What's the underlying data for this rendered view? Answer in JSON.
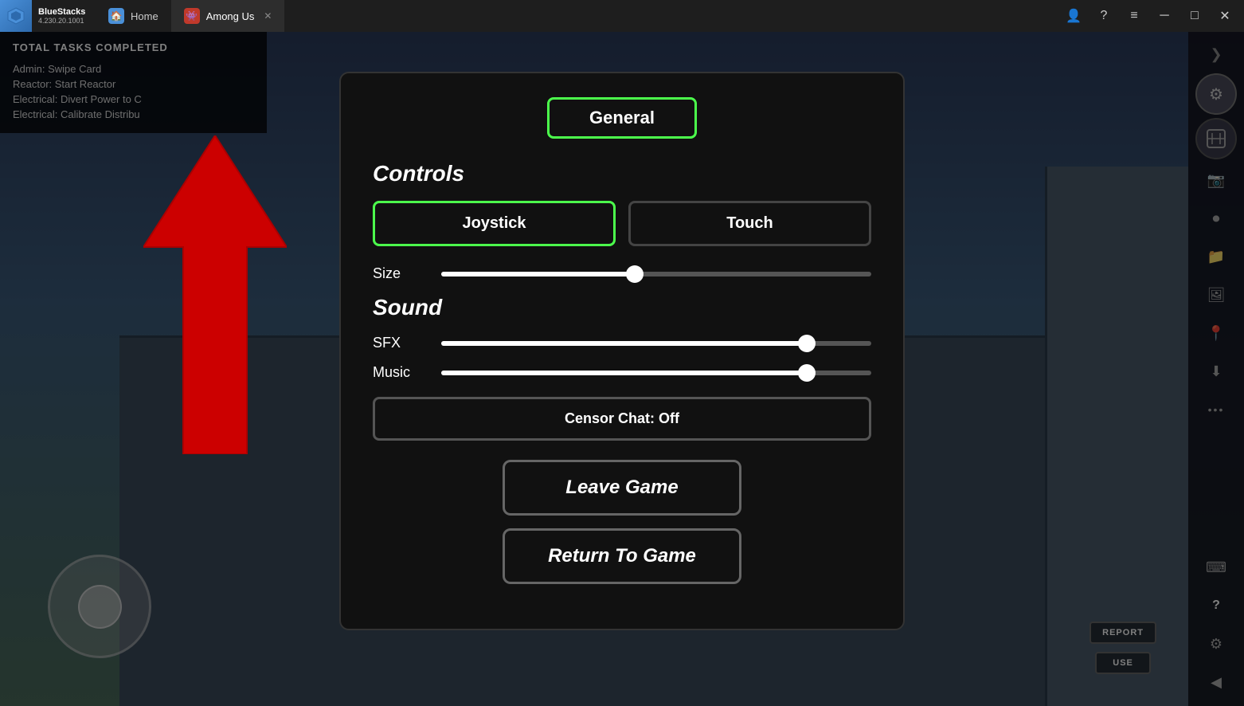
{
  "titlebar": {
    "app_name": "BlueStacks",
    "version": "4.230.20.1001",
    "tabs": [
      {
        "label": "Home",
        "active": false
      },
      {
        "label": "Among Us",
        "active": true
      }
    ],
    "controls": {
      "profile": "👤",
      "help": "?",
      "menu": "≡",
      "minimize": "─",
      "maximize": "□",
      "close": "✕",
      "expand": "⟨"
    }
  },
  "tasks": {
    "title": "TOTAL TASKS COMPLETED",
    "items": [
      "Admin: Swipe Card",
      "Reactor: Start Reactor",
      "Electrical: Divert Power to C",
      "Electrical: Calibrate Distribu"
    ]
  },
  "sidebar": {
    "gear_icon": "⚙",
    "map_icon": "🗺",
    "camera_icon": "📷",
    "record_icon": "⏺",
    "folder_icon": "📁",
    "screenshot_icon": "🖼",
    "pin_icon": "📍",
    "download_icon": "⬇",
    "more_icon": "•••",
    "keyboard_icon": "⌨",
    "help_icon": "?",
    "settings_icon": "⚙",
    "back_icon": "◀",
    "expand_icon": "❯"
  },
  "modal": {
    "tab_general": "General",
    "section_controls": "Controls",
    "btn_joystick": "Joystick",
    "btn_touch": "Touch",
    "section_sound": "Sound",
    "label_size": "Size",
    "label_sfx": "SFX",
    "label_music": "Music",
    "slider_size_pct": 45,
    "slider_sfx_pct": 85,
    "slider_music_pct": 85,
    "btn_censor": "Censor Chat: Off",
    "btn_leave": "Leave Game",
    "btn_return": "Return To Game"
  },
  "joystick": {
    "label": "joystick"
  },
  "colors": {
    "active_green": "#4cff4c",
    "bg_dark": "#111111",
    "border_default": "#555555",
    "white": "#ffffff",
    "red_arrow": "#cc0000"
  }
}
